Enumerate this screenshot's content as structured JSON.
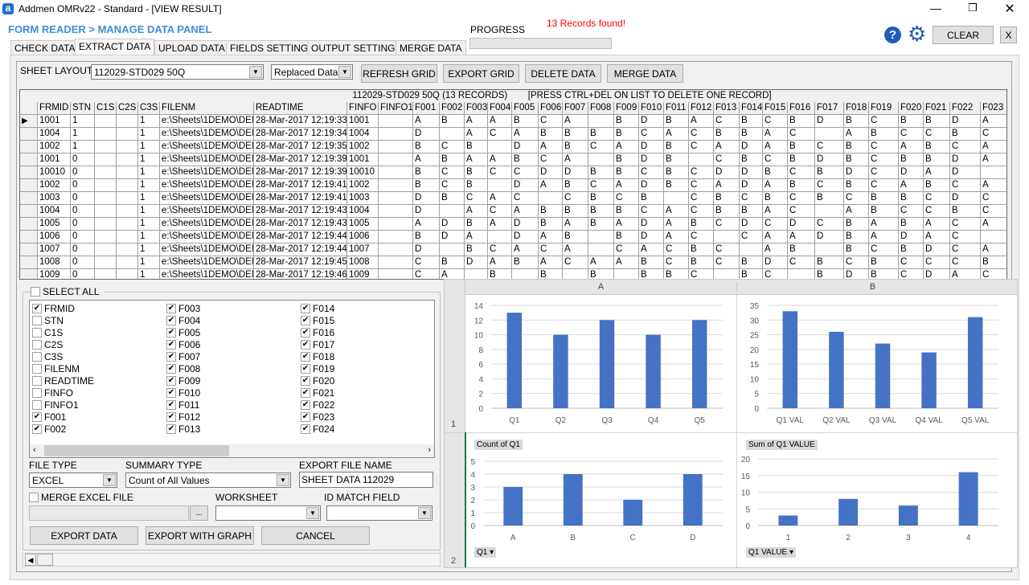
{
  "window": {
    "title": "Addmen OMRv22 - Standard - [VIEW RESULT]",
    "controls": [
      "minimize",
      "restore",
      "close"
    ]
  },
  "header": {
    "breadcrumb": "FORM READER > MANAGE DATA PANEL",
    "progress_label": "PROGRESS",
    "progress": 0,
    "status": "13 Records found!",
    "status_color": "#ff0000",
    "accent": "#3d8fd8",
    "clear_label": "CLEAR",
    "close_label": "X"
  },
  "tabs": [
    {
      "label": "CHECK DATA"
    },
    {
      "label": "EXTRACT DATA",
      "active": true
    },
    {
      "label": "UPLOAD DATA"
    },
    {
      "label": "FIELDS SETTING"
    },
    {
      "label": "OUTPUT SETTING"
    },
    {
      "label": "MERGE DATA"
    }
  ],
  "toolbar": {
    "sheet_layout_label": "SHEET LAYOUT:",
    "sheet_layout": "112029-STD029 50Q",
    "data_mode": "Replaced Data",
    "refresh": "REFRESH GRID",
    "export": "EXPORT GRID",
    "delete": "DELETE DATA",
    "merge": "MERGE DATA"
  },
  "grid": {
    "caption": "112029-STD029 50Q (13 RECORDS)        [PRESS CTRL+DEL ON LIST TO DELETE ONE RECORD]",
    "columns": [
      "FRMID",
      "STN",
      "C1S",
      "C2S",
      "C3S",
      "FILENM",
      "READTIME",
      "FINFO",
      "FINFO1",
      "F001",
      "F002",
      "F003",
      "F004",
      "F005",
      "F006",
      "F007",
      "F008",
      "F009",
      "F010",
      "F011",
      "F012",
      "F013",
      "F014",
      "F015",
      "F016",
      "F017",
      "F018",
      "F019",
      "F020",
      "F021",
      "F022",
      "F023"
    ],
    "rows": [
      [
        "1001",
        "1",
        "",
        "",
        "1",
        "e:\\Sheets\\1DEMO\\DEM",
        "28-Mar-2017 12:19:33 PM",
        "1001",
        "",
        "A",
        "B",
        "A",
        "A",
        "B",
        "C",
        "A",
        "",
        "B",
        "D",
        "B",
        "A",
        "C",
        "B",
        "C",
        "B",
        "D",
        "B",
        "C",
        "B",
        "B",
        "D",
        "A"
      ],
      [
        "1004",
        "1",
        "",
        "",
        "1",
        "e:\\Sheets\\1DEMO\\DEM",
        "28-Mar-2017 12:19:34 PM",
        "1004",
        "",
        "D",
        "",
        "A",
        "C",
        "A",
        "B",
        "B",
        "B",
        "B",
        "C",
        "A",
        "C",
        "B",
        "B",
        "A",
        "C",
        "",
        "A",
        "B",
        "C",
        "C",
        "B",
        "C"
      ],
      [
        "1002",
        "1",
        "",
        "",
        "1",
        "e:\\Sheets\\1DEMO\\DEM",
        "28-Mar-2017 12:19:35 PM",
        "1002",
        "",
        "B",
        "C",
        "B",
        "",
        "D",
        "A",
        "B",
        "C",
        "A",
        "D",
        "B",
        "C",
        "A",
        "D",
        "A",
        "B",
        "C",
        "B",
        "C",
        "A",
        "B",
        "C",
        "A"
      ],
      [
        "1001",
        "0",
        "",
        "",
        "1",
        "e:\\Sheets\\1DEMO\\DEM",
        "28-Mar-2017 12:19:39 PM",
        "1001",
        "",
        "A",
        "B",
        "A",
        "A",
        "B",
        "C",
        "A",
        "",
        "B",
        "D",
        "B",
        "",
        "C",
        "B",
        "C",
        "B",
        "D",
        "B",
        "C",
        "B",
        "B",
        "D",
        "A"
      ],
      [
        "10010",
        "0",
        "",
        "",
        "1",
        "e:\\Sheets\\1DEMO\\DEM",
        "28-Mar-2017 12:19:39 PM",
        "10010",
        "",
        "B",
        "C",
        "B",
        "C",
        "C",
        "D",
        "D",
        "B",
        "B",
        "C",
        "B",
        "C",
        "D",
        "D",
        "B",
        "C",
        "B",
        "D",
        "C",
        "D",
        "A",
        "D",
        ""
      ],
      [
        "1002",
        "0",
        "",
        "",
        "1",
        "e:\\Sheets\\1DEMO\\DEM",
        "28-Mar-2017 12:19:41 PM",
        "1002",
        "",
        "B",
        "C",
        "B",
        "",
        "D",
        "A",
        "B",
        "C",
        "A",
        "D",
        "B",
        "C",
        "A",
        "D",
        "A",
        "B",
        "C",
        "B",
        "C",
        "A",
        "B",
        "C",
        "A"
      ],
      [
        "1003",
        "0",
        "",
        "",
        "1",
        "e:\\Sheets\\1DEMO\\DEM",
        "28-Mar-2017 12:19:41 PM",
        "1003",
        "",
        "D",
        "B",
        "C",
        "A",
        "C",
        "",
        "C",
        "B",
        "C",
        "B",
        "",
        "C",
        "B",
        "C",
        "B",
        "C",
        "B",
        "C",
        "B",
        "B",
        "C",
        "D",
        "C"
      ],
      [
        "1004",
        "0",
        "",
        "",
        "1",
        "e:\\Sheets\\1DEMO\\DEM",
        "28-Mar-2017 12:19:43 PM",
        "1004",
        "",
        "D",
        "",
        "A",
        "C",
        "A",
        "B",
        "B",
        "B",
        "B",
        "C",
        "A",
        "C",
        "B",
        "B",
        "A",
        "C",
        "",
        "A",
        "B",
        "C",
        "C",
        "B",
        "C"
      ],
      [
        "1005",
        "0",
        "",
        "",
        "1",
        "e:\\Sheets\\1DEMO\\DEM",
        "28-Mar-2017 12:19:43 PM",
        "1005",
        "",
        "A",
        "D",
        "B",
        "A",
        "D",
        "B",
        "A",
        "B",
        "A",
        "D",
        "A",
        "B",
        "C",
        "D",
        "C",
        "D",
        "C",
        "B",
        "A",
        "B",
        "A",
        "C",
        "A"
      ],
      [
        "1006",
        "0",
        "",
        "",
        "1",
        "e:\\Sheets\\1DEMO\\DEM",
        "28-Mar-2017 12:19:44 PM",
        "1006",
        "",
        "B",
        "D",
        "A",
        "",
        "D",
        "A",
        "B",
        "",
        "B",
        "D",
        "A",
        "C",
        "",
        "C",
        "A",
        "A",
        "D",
        "B",
        "A",
        "D",
        "A",
        "C",
        ""
      ],
      [
        "1007",
        "0",
        "",
        "",
        "1",
        "e:\\Sheets\\1DEMO\\DEM",
        "28-Mar-2017 12:19:44 PM",
        "1007",
        "",
        "D",
        "",
        "B",
        "C",
        "A",
        "C",
        "A",
        "",
        "C",
        "A",
        "C",
        "B",
        "C",
        "",
        "A",
        "B",
        "",
        "B",
        "C",
        "B",
        "D",
        "C",
        "A"
      ],
      [
        "1008",
        "0",
        "",
        "",
        "1",
        "e:\\Sheets\\1DEMO\\DEM",
        "28-Mar-2017 12:19:45 PM",
        "1008",
        "",
        "C",
        "B",
        "D",
        "A",
        "B",
        "A",
        "C",
        "A",
        "A",
        "B",
        "C",
        "B",
        "C",
        "B",
        "D",
        "C",
        "B",
        "C",
        "B",
        "C",
        "C",
        "C",
        "B"
      ],
      [
        "1009",
        "0",
        "",
        "",
        "1",
        "e:\\Sheets\\1DEMO\\DEM",
        "28-Mar-2017 12:19:46 PM",
        "1009",
        "",
        "C",
        "A",
        "",
        "B",
        "",
        "B",
        "",
        "B",
        "",
        "B",
        "B",
        "C",
        "",
        "B",
        "C",
        "",
        "B",
        "D",
        "B",
        "C",
        "D",
        "A",
        "C"
      ]
    ]
  },
  "fields": {
    "select_all_label": "SELECT ALL",
    "select_all": false,
    "items": [
      {
        "label": "FRMID",
        "checked": true
      },
      {
        "label": "STN",
        "checked": false
      },
      {
        "label": "C1S",
        "checked": false
      },
      {
        "label": "C2S",
        "checked": false
      },
      {
        "label": "C3S",
        "checked": false
      },
      {
        "label": "FILENM",
        "checked": false
      },
      {
        "label": "READTIME",
        "checked": false
      },
      {
        "label": "FINFO",
        "checked": false
      },
      {
        "label": "FINFO1",
        "checked": false
      },
      {
        "label": "F001",
        "checked": true
      },
      {
        "label": "F002",
        "checked": true
      },
      {
        "label": "F003",
        "checked": true
      },
      {
        "label": "F004",
        "checked": true
      },
      {
        "label": "F005",
        "checked": true
      },
      {
        "label": "F006",
        "checked": true
      },
      {
        "label": "F007",
        "checked": true
      },
      {
        "label": "F008",
        "checked": true
      },
      {
        "label": "F009",
        "checked": true
      },
      {
        "label": "F010",
        "checked": true
      },
      {
        "label": "F011",
        "checked": true
      },
      {
        "label": "F012",
        "checked": true
      },
      {
        "label": "F013",
        "checked": true
      },
      {
        "label": "F014",
        "checked": true
      },
      {
        "label": "F015",
        "checked": true
      },
      {
        "label": "F016",
        "checked": true
      },
      {
        "label": "F017",
        "checked": true
      },
      {
        "label": "F018",
        "checked": true
      },
      {
        "label": "F019",
        "checked": true
      },
      {
        "label": "F020",
        "checked": true
      },
      {
        "label": "F021",
        "checked": true
      },
      {
        "label": "F022",
        "checked": true
      },
      {
        "label": "F023",
        "checked": true
      },
      {
        "label": "F024",
        "checked": true
      }
    ]
  },
  "export": {
    "file_type_label": "FILE TYPE",
    "file_type": "EXCEL",
    "summary_type_label": "SUMMARY TYPE",
    "summary_type": "Count of All Values",
    "file_name_label": "EXPORT FILE NAME",
    "file_name": "SHEET DATA 112029",
    "merge_label": "MERGE EXCEL FILE",
    "browse": "...",
    "worksheet_label": "WORKSHEET",
    "id_match_label": "ID MATCH FIELD",
    "export_data": "EXPORT DATA",
    "export_graph": "EXPORT WITH GRAPH",
    "cancel": "CANCEL"
  },
  "sheet": {
    "col_headers": [
      "A",
      "B"
    ],
    "row_headers": [
      "1",
      "2"
    ],
    "bar_color": "#4472c4"
  },
  "chart_data": [
    {
      "type": "bar",
      "categories": [
        "Q1",
        "Q2",
        "Q3",
        "Q4",
        "Q5"
      ],
      "values": [
        13,
        10,
        12,
        10,
        12
      ],
      "ylim": [
        0,
        14
      ],
      "yticks": [
        0,
        2,
        4,
        6,
        8,
        10,
        12,
        14
      ],
      "grid": true
    },
    {
      "type": "bar",
      "categories": [
        "Q1 VAL",
        "Q2 VAL",
        "Q3 VAL",
        "Q4 VAL",
        "Q5 VAL"
      ],
      "values": [
        33,
        26,
        22,
        19,
        31
      ],
      "ylim": [
        0,
        35
      ],
      "yticks": [
        0,
        5,
        10,
        15,
        20,
        25,
        30,
        35
      ],
      "grid": true
    },
    {
      "type": "bar",
      "title": "Count of Q1",
      "filter": "Q1",
      "categories": [
        "A",
        "B",
        "C",
        "D"
      ],
      "values": [
        3,
        4,
        2,
        4
      ],
      "ylim": [
        0,
        5
      ],
      "yticks": [
        0,
        1,
        2,
        3,
        4,
        5
      ],
      "grid": true
    },
    {
      "type": "bar",
      "title": "Sum of Q1 VALUE",
      "filter": "Q1 VALUE",
      "categories": [
        "1",
        "2",
        "3",
        "4"
      ],
      "values": [
        3,
        8,
        6,
        16
      ],
      "ylim": [
        0,
        20
      ],
      "yticks": [
        0,
        5,
        10,
        15,
        20
      ],
      "grid": true
    }
  ]
}
